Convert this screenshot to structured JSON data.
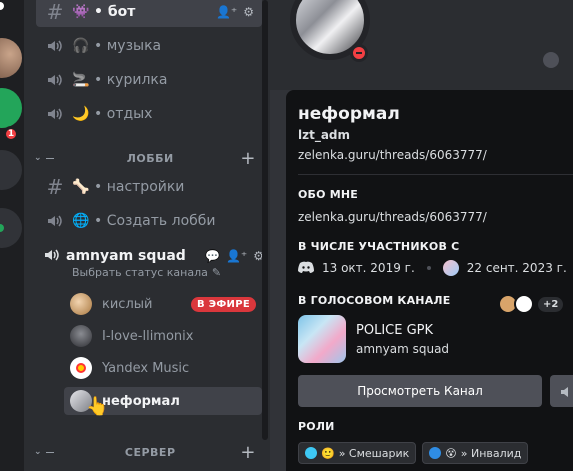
{
  "colors": {
    "accent_live": "#da373c",
    "dnd_status": "#f23f43",
    "mention_badge": "#f23f43",
    "active_bg": "#404249",
    "voice_avatar_1": "#d8a46a",
    "voice_avatar_2": "#5b5d63",
    "voice_avatar_3": "#ffffff",
    "role_1": "#3ec8f4",
    "role_2": "#2f8de4"
  },
  "rail": {
    "mention_count": "1"
  },
  "channels": [
    {
      "type": "text",
      "emoji": "👾",
      "name": "бот",
      "active": true
    },
    {
      "type": "voice",
      "emoji": "🎧",
      "name": "музыка"
    },
    {
      "type": "voice",
      "emoji": "🚬",
      "name": "курилка"
    },
    {
      "type": "voice",
      "emoji": "🌙",
      "name": "отдых"
    }
  ],
  "category_lobby": "ЛОББИ",
  "lobby_channels": [
    {
      "type": "text",
      "emoji": "🦴",
      "name": "настройки"
    },
    {
      "type": "voice",
      "emoji": "🌐",
      "name": "Создать лобби"
    }
  ],
  "voice_channel": {
    "name": "amnyam squad",
    "status_placeholder": "Выбрать статус канала",
    "users": [
      {
        "name": "кислый",
        "live_label": "В ЭФИРЕ"
      },
      {
        "name": "I-love-llimonix"
      },
      {
        "name": "Yandex Music"
      },
      {
        "name": "неформал",
        "active": true
      }
    ]
  },
  "category_server": "СЕРВЕР",
  "profile": {
    "display_name": "неформал",
    "username": "lzt_adm",
    "pronouns_link": "zelenka.guru/threads/6063777/",
    "about_title": "ОБО МНЕ",
    "about_text": "zelenka.guru/threads/6063777/",
    "member_since_title": "В ЧИСЛЕ УЧАСТНИКОВ С",
    "discord_since": "13 окт. 2019 г.",
    "server_since": "22 сент. 2023 г.",
    "voice_title": "В ГОЛОСОВОМ КАНАЛЕ",
    "voice_more": "+2",
    "voice_card_title": "POLICE GPK",
    "voice_card_sub": "amnyam squad",
    "view_channel_label": "Просмотреть Канал",
    "roles_title": "РОЛИ",
    "roles": [
      {
        "emoji": "🙂",
        "name": "» Смешарик"
      },
      {
        "emoji": "😵",
        "name": "» Инвалид"
      }
    ]
  }
}
